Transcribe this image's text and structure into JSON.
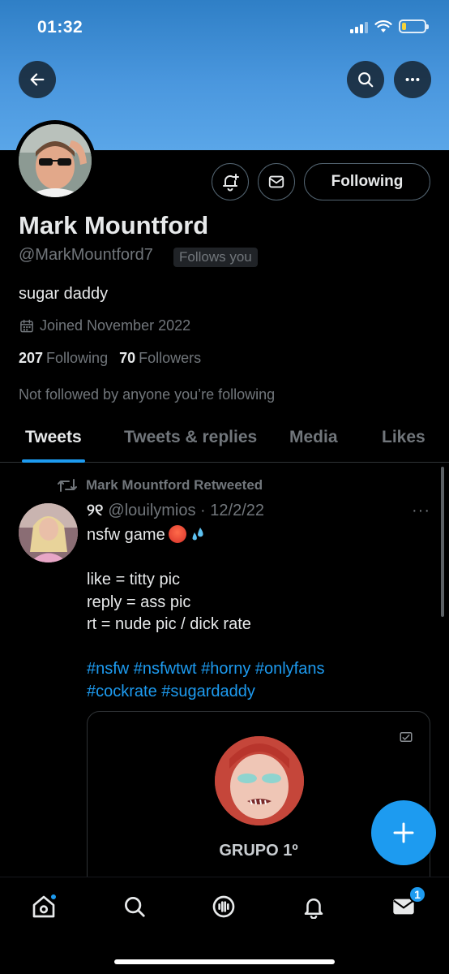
{
  "status_bar": {
    "time": "01:32",
    "battery_color": "#f5d33a",
    "battery_level": 0.2
  },
  "header": {
    "back_icon": "arrow-left-icon",
    "search_icon": "search-icon",
    "more_icon": "more-horizontal-icon"
  },
  "profile": {
    "name": "Mark Mountford",
    "handle": "@MarkMountford7",
    "follows_you": "Follows you",
    "bio": "sugar daddy",
    "joined": "Joined November 2022",
    "following_count": "207",
    "following_label": "Following",
    "followers_count": "70",
    "followers_label": "Followers",
    "not_followed": "Not followed by anyone you’re following",
    "following_button": "Following"
  },
  "tabs": [
    {
      "label": "Tweets",
      "active": true
    },
    {
      "label": "Tweets & replies",
      "active": false
    },
    {
      "label": "Media",
      "active": false
    },
    {
      "label": "Likes",
      "active": false
    }
  ],
  "tweet": {
    "retweeted_by": "Mark Mountford Retweeted",
    "display_name": "୨୧",
    "handle_date": "@louilymios · 12/2/22",
    "more": "···",
    "lines": [
      "nsfw game",
      "",
      "like = titty pic",
      "reply = ass pic",
      "rt = nude pic / dick rate",
      ""
    ],
    "hashtags_line1": "#nsfw #nsfwtwt #horny #onlyfans",
    "hashtags_line2": "#cockrate #sugardaddy",
    "card": {
      "title": "GRUPO 1º"
    }
  },
  "bottom_nav": {
    "items": [
      "home-icon",
      "search-icon",
      "spaces-icon",
      "notifications-icon",
      "messages-icon"
    ],
    "messages_badge": "1"
  },
  "colors": {
    "accent": "#1d9bf0",
    "banner": "#4a97de",
    "background": "#000000",
    "muted": "#71767b"
  }
}
